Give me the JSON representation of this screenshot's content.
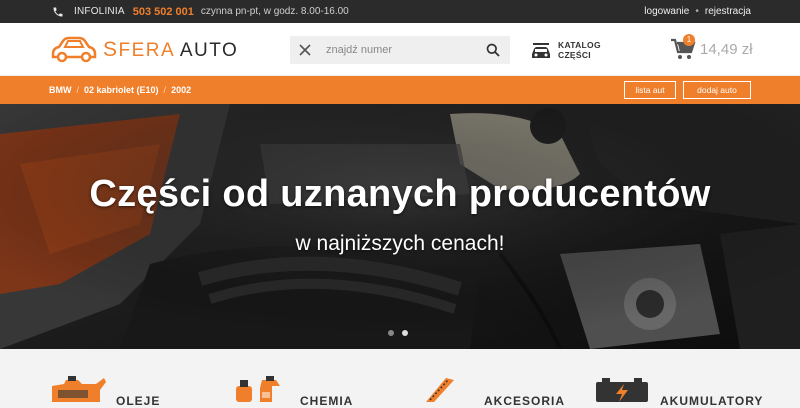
{
  "topbar": {
    "info_label": "INFOLINIA",
    "phone": "503 502 001",
    "hours": "czynna pn-pt, w godz. 8.00-16.00",
    "login": "logowanie",
    "separator": "•",
    "register": "rejestracja"
  },
  "header": {
    "logo_word1": "FERA",
    "logo_s": "S",
    "logo_word2": "AUTO",
    "search_placeholder": "znajdź numer",
    "catalog_line1": "KATALOG",
    "catalog_line2": "CZĘŚCI",
    "cart_count": "1",
    "cart_total": "14,49 zł"
  },
  "breadcrumb": {
    "items": [
      "BMW",
      "02 kabriolet (E10)",
      "2002"
    ],
    "separator": "/",
    "btn_list": "lista aut",
    "btn_add": "dodaj auto"
  },
  "hero": {
    "title": "Części od uznanych producentów",
    "subtitle": "w najniższych cenach!",
    "slides": 2,
    "active_slide": 2
  },
  "categories": [
    {
      "label": "OLEJE",
      "icon": "oil-can-icon"
    },
    {
      "label": "CHEMIA",
      "icon": "spray-bottle-icon"
    },
    {
      "label": "AKCESORIA",
      "icon": "accessories-icon"
    },
    {
      "label": "AKUMULATORY",
      "icon": "battery-icon"
    }
  ],
  "colors": {
    "accent": "#f07f2b",
    "dark": "#2b2b2b"
  }
}
